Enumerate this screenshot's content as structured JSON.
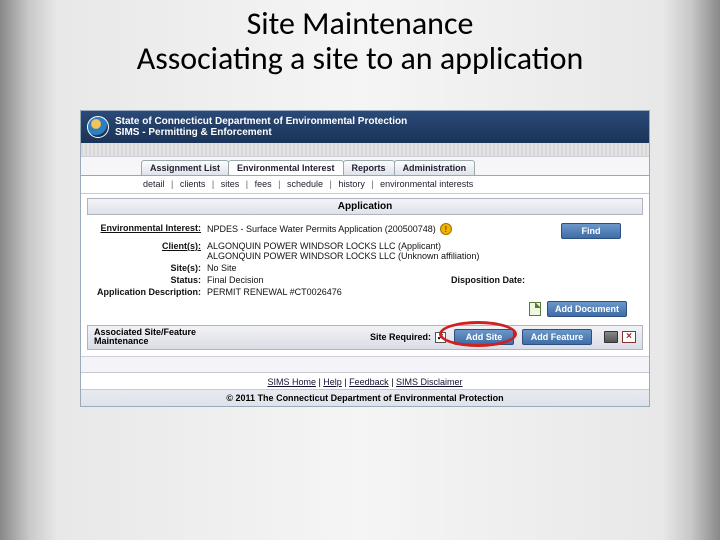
{
  "slide": {
    "title_line1": "Site Maintenance",
    "title_line2": "Associating a site to an application"
  },
  "header": {
    "org": "State of Connecticut Department of Environmental Protection",
    "system": "SIMS - Permitting & Enforcement"
  },
  "main_tabs": [
    {
      "label": "Assignment List",
      "active": false
    },
    {
      "label": "Environmental Interest",
      "active": true
    },
    {
      "label": "Reports",
      "active": false
    },
    {
      "label": "Administration",
      "active": false
    }
  ],
  "sub_nav": [
    "detail",
    "clients",
    "sites",
    "fees",
    "schedule",
    "history",
    "environmental interests"
  ],
  "application": {
    "section_title": "Application",
    "env_interest_label": "Environmental Interest:",
    "env_interest_value": "NPDES - Surface Water Permits Application (200500748)",
    "find_label": "Find",
    "clients_label": "Client(s):",
    "clients_value_1": "ALGONQUIN POWER WINDSOR LOCKS LLC (Applicant)",
    "clients_value_2": "ALGONQUIN POWER WINDSOR LOCKS LLC (Unknown affiliation)",
    "sites_label": "Site(s):",
    "sites_value": "No Site",
    "status_label": "Status:",
    "status_value": "Final Decision",
    "disposition_label": "Disposition Date:",
    "app_desc_label": "Application Description:",
    "app_desc_value": "PERMIT RENEWAL #CT0026476",
    "add_document_label": "Add Document"
  },
  "assoc": {
    "title_line1": "Associated Site/Feature",
    "title_line2": "Maintenance",
    "site_required_label": "Site Required:",
    "site_required_checked": true,
    "add_site_label": "Add Site",
    "add_feature_label": "Add Feature"
  },
  "footer": {
    "links": [
      "SIMS Home",
      "Help",
      "Feedback",
      "SIMS Disclaimer"
    ],
    "copyright": "© 2011 The Connecticut Department of Environmental Protection"
  }
}
